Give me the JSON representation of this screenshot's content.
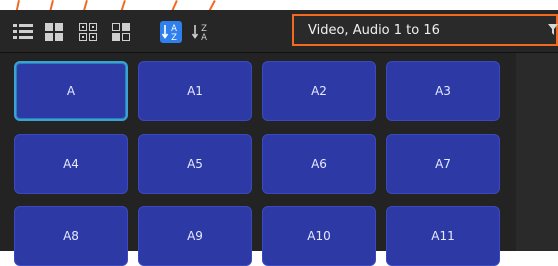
{
  "toolbar": {
    "buttons": [
      {
        "id": "list-view",
        "icon": "list-icon",
        "active": false
      },
      {
        "id": "large-tiles",
        "icon": "grid-large-icon",
        "active": false
      },
      {
        "id": "medium-tiles",
        "icon": "grid-medium-icon",
        "active": false
      },
      {
        "id": "small-tiles",
        "icon": "grid-small-icon",
        "active": false
      },
      {
        "id": "sort-az",
        "icon": "sort-a-z-icon",
        "active": true
      },
      {
        "id": "sort-za",
        "icon": "sort-z-a-icon",
        "active": false
      }
    ],
    "sort_az_glyph_top": "A",
    "sort_az_glyph_bottom": "Z",
    "sort_za_glyph_top": "Z",
    "sort_za_glyph_bottom": "A"
  },
  "filter": {
    "value": "Video, Audio 1 to 16",
    "icon": "filter-icon"
  },
  "tiles": [
    "A",
    "A1",
    "A2",
    "A3",
    "A4",
    "A5",
    "A6",
    "A7",
    "A8",
    "A9",
    "A10",
    "A11"
  ],
  "selected_tile": "A",
  "colors": {
    "accent": "#f26a21",
    "tile": "#2d3aa6",
    "active_button": "#2f80ed",
    "selection": "#3aa2d8"
  }
}
